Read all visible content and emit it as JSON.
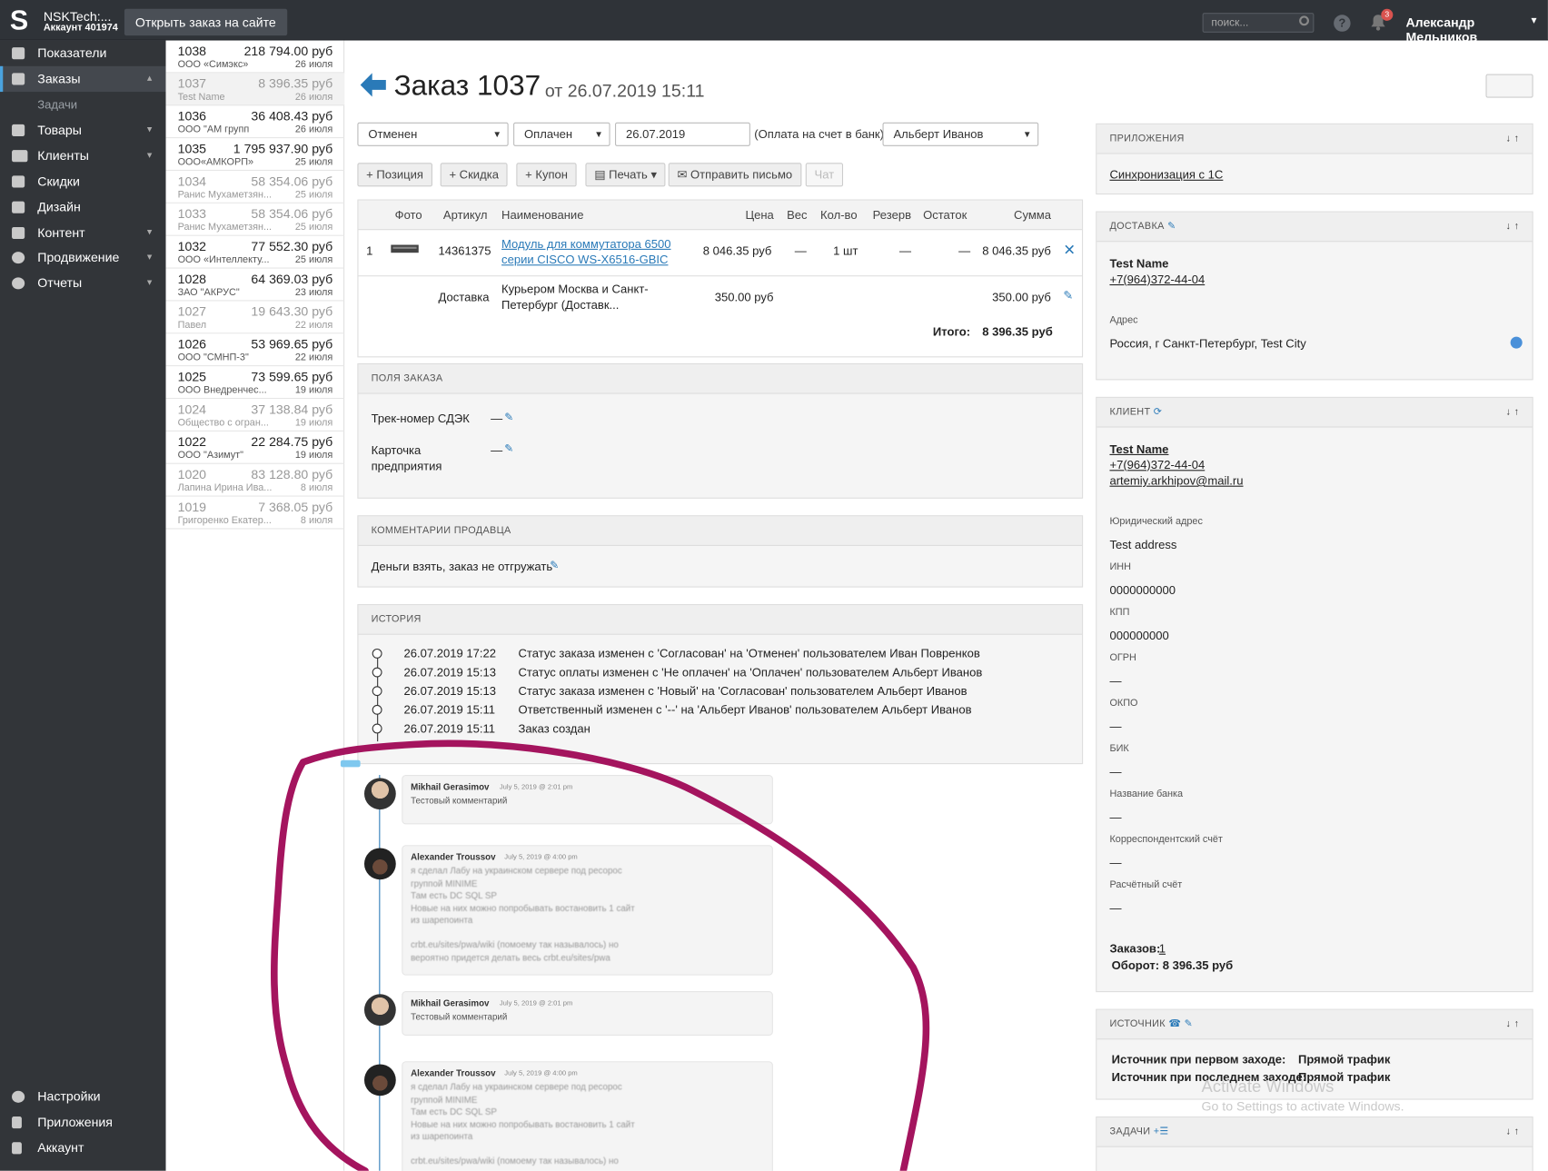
{
  "topbar": {
    "logo": "S",
    "account_name": "NSKTech:...",
    "account_number": "Аккаунт 401974",
    "open_site_label": "Открыть заказ на сайте",
    "search_placeholder": "поиск...",
    "help": "?",
    "notif_count": "3",
    "user": "Александр Мельников",
    "user_caret": "▾"
  },
  "sidebar": {
    "items": [
      {
        "label": "Показатели",
        "icon": "chart-icon"
      },
      {
        "label": "Заказы",
        "icon": "cart-icon",
        "chevron": "▴"
      },
      {
        "label": "Задачи"
      },
      {
        "label": "Товары",
        "icon": "books-icon",
        "chevron": "▾"
      },
      {
        "label": "Клиенты",
        "icon": "users-icon",
        "chevron": "▾"
      },
      {
        "label": "Скидки",
        "icon": "gift-icon"
      },
      {
        "label": "Дизайн",
        "icon": "image-icon"
      },
      {
        "label": "Контент",
        "icon": "pages-icon",
        "chevron": "▾"
      },
      {
        "label": "Продвижение",
        "icon": "target-icon",
        "chevron": "▾"
      },
      {
        "label": "Отчеты",
        "icon": "pie-icon",
        "chevron": "▾"
      }
    ],
    "bottom": [
      {
        "label": "Настройки",
        "icon": "gear-icon"
      },
      {
        "label": "Приложения",
        "icon": "plug-icon"
      },
      {
        "label": "Аккаунт",
        "icon": "user-icon"
      }
    ]
  },
  "orders": [
    {
      "num": "1038",
      "sum": "218 794.00 руб",
      "who": "ООО «Симэкс»",
      "date": "26 июля"
    },
    {
      "num": "1037",
      "sum": "8 396.35 руб",
      "who": "Test Name",
      "date": "26 июля"
    },
    {
      "num": "1036",
      "sum": "36 408.43 руб",
      "who": "ООО \"АМ групп",
      "date": "26 июля"
    },
    {
      "num": "1035",
      "sum": "1 795 937.90 руб",
      "who": "ООО«АМКОРП»",
      "date": "25 июля"
    },
    {
      "num": "1034",
      "sum": "58 354.06 руб",
      "who": "Ранис Мухаметзян...",
      "date": "25 июля"
    },
    {
      "num": "1033",
      "sum": "58 354.06 руб",
      "who": "Ранис Мухаметзян...",
      "date": "25 июля"
    },
    {
      "num": "1032",
      "sum": "77 552.30 руб",
      "who": "ООО «Интеллекту...",
      "date": "25 июля"
    },
    {
      "num": "1028",
      "sum": "64 369.03 руб",
      "who": "ЗАО \"АКРУС\"",
      "date": "23 июля"
    },
    {
      "num": "1027",
      "sum": "19 643.30 руб",
      "who": "Павел",
      "date": "22 июля"
    },
    {
      "num": "1026",
      "sum": "53 969.65 руб",
      "who": "ООО \"СМНП-3\"",
      "date": "22 июля"
    },
    {
      "num": "1025",
      "sum": "73 599.65 руб",
      "who": "ООО Внедренчес...",
      "date": "19 июля"
    },
    {
      "num": "1024",
      "sum": "37 138.84 руб",
      "who": "Общество с огран...",
      "date": "19 июля"
    },
    {
      "num": "1022",
      "sum": "22 284.75 руб",
      "who": "ООО \"Азимут\"",
      "date": "19 июля"
    },
    {
      "num": "1020",
      "sum": "83 128.80 руб",
      "who": "Лапина Ирина Ива...",
      "date": "8 июля"
    },
    {
      "num": "1019",
      "sum": "7 368.05 руб",
      "who": "Григоренко Екатер...",
      "date": "8 июля"
    }
  ],
  "order": {
    "title": "Заказ 1037",
    "date": "от 26.07.2019 15:11",
    "status": "Отменен",
    "payment": "Оплачен",
    "pay_date": "26.07.2019",
    "pay_note": "(Оплата на счет в банк)",
    "manager": "Альберт Иванов"
  },
  "toolbar": {
    "position": "+ Позиция",
    "discount": "+ Скидка",
    "coupon": "+ Купон",
    "print": "Печать",
    "send": "Отправить письмо",
    "chat": "Чат"
  },
  "items": {
    "headers": {
      "photo": "Фото",
      "sku": "Артикул",
      "name": "Наименование",
      "price": "Цена",
      "weight": "Вес",
      "qty": "Кол-во",
      "reserve": "Резерв",
      "stock": "Остаток",
      "sum": "Сумма"
    },
    "rows": [
      {
        "idx": "1",
        "sku": "14361375",
        "name1": "Модуль для коммутатора 6500",
        "name2": "серии CISCO WS-X6516-GBIC",
        "price": "8 046.35 руб",
        "weight": "—",
        "qty": "1 шт",
        "reserve": "—",
        "stock": "—",
        "sum": "8 046.35 руб"
      }
    ],
    "delivery": {
      "sku": "Доставка",
      "name1": "Курьером Москва и Санкт-",
      "name2": "Петербург (Доставк...",
      "price": "350.00 руб",
      "sum": "350.00 руб"
    },
    "total_label": "Итого:",
    "total": "8 396.35 руб"
  },
  "fields": {
    "title": "ПОЛЯ ЗАКАЗА",
    "track_label": "Трек-номер СДЭК",
    "track_value": "—",
    "card_label1": "Карточка",
    "card_label2": "предприятия",
    "card_value": "—"
  },
  "comments_seller": {
    "title": "КОММЕНТАРИИ ПРОДАВЦА",
    "text": "Деньги взять, заказ не отгружать"
  },
  "history": {
    "title": "ИСТОРИЯ",
    "rows": [
      {
        "t": "26.07.2019 17:22",
        "m": "Статус заказа изменен с 'Согласован' на 'Отменен' пользователем Иван Повренков"
      },
      {
        "t": "26.07.2019 15:13",
        "m": "Статус оплаты изменен с 'Не оплачен' на 'Оплачен' пользователем Альберт Иванов"
      },
      {
        "t": "26.07.2019 15:13",
        "m": "Статус заказа изменен с 'Новый' на 'Согласован' пользователем Альберт Иванов"
      },
      {
        "t": "26.07.2019 15:11",
        "m": "Ответственный изменен с '--' на 'Альберт Иванов' пользователем Альберт Иванов"
      },
      {
        "t": "26.07.2019 15:11",
        "m": "Заказ создан"
      }
    ]
  },
  "chat": [
    {
      "author": "Mikhail Gerasimov",
      "date": "July 5, 2019 @ 2:01 pm",
      "body": "Тестовый комментарий"
    },
    {
      "author": "Alexander Troussov",
      "date": "July 5, 2019 @ 4:00 pm",
      "body": "я сделал Лабу на украинском сервере под ресорос\nгруппой MINIME\nТам есть DC SQL SP\nНовые на них можно попробывать востановить 1 сайт\nиз шарепоинта\n\ncrbt.eu/sites/pwa/wiki (помоему так называлось) но\nвероятно придется делать весь crbt.eu/sites/pwa"
    },
    {
      "author": "Mikhail Gerasimov",
      "date": "July 5, 2019 @ 2:01 pm",
      "body": "Тестовый комментарий"
    },
    {
      "author": "Alexander Troussov",
      "date": "July 5, 2019 @ 4:00 pm",
      "body": "я сделал Лабу на украинском сервере под ресорос\nгруппой MINIME\nТам есть DC SQL SP\nНовые на них можно попробывать востановить 1 сайт\nиз шарепоинта\n\ncrbt.eu/sites/pwa/wiki (помоему так называлось) но"
    }
  ],
  "right": {
    "apps": {
      "title": "ПРИЛОЖЕНИЯ",
      "link": "Синхронизация с 1С"
    },
    "delivery": {
      "title": "ДОСТАВКА",
      "name": "Test Name",
      "phone": "+7(964)372-44-04",
      "addr_label": "Адрес",
      "address": "Россия, г Санкт-Петербург, Test City"
    },
    "client": {
      "title": "КЛИЕНТ",
      "name": "Test Name",
      "phone": "+7(964)372-44-04",
      "email": "artemiy.arkhipov@mail.ru",
      "fields": [
        {
          "l": "Юридический адрес",
          "v": "Test address"
        },
        {
          "l": "ИНН",
          "v": "0000000000"
        },
        {
          "l": "КПП",
          "v": "000000000"
        },
        {
          "l": "ОГРН",
          "v": "—"
        },
        {
          "l": "ОКПО",
          "v": "—"
        },
        {
          "l": "БИК",
          "v": "—"
        },
        {
          "l": "Название банка",
          "v": "—"
        },
        {
          "l": "Корреспондентский счёт",
          "v": "—"
        },
        {
          "l": "Расчётный счёт",
          "v": "—"
        }
      ],
      "orders_label": "Заказов:",
      "orders_count": "1",
      "turnover": "Оборот: 8 396.35 руб"
    },
    "source": {
      "title": "ИСТОЧНИК",
      "first_label": "Источник при первом заходе:",
      "first_value": "Прямой трафик",
      "last_label": "Источник при последнем заходе:",
      "last_value": "Прямой трафик"
    },
    "tasks": {
      "title": "ЗАДАЧИ"
    },
    "arrows": "🠗🠕"
  },
  "watermark": {
    "line1": "Activate Windows",
    "line2": "Go to Settings to activate Windows."
  },
  "colors": {
    "accent": "#2a7ab8",
    "sidebar": "#323539",
    "topbar": "#2f3338",
    "annotation": "#a4145e"
  }
}
